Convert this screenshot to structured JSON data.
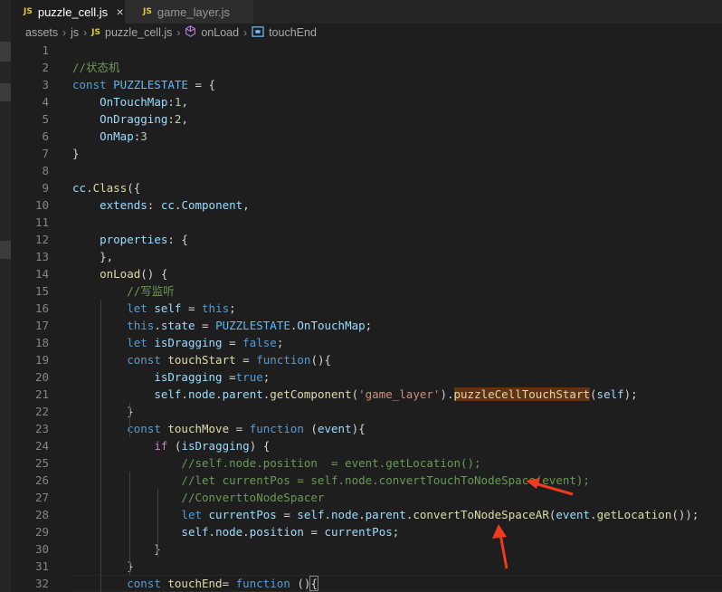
{
  "tabs": [
    {
      "badge": "JS",
      "label": "puzzle_cell.js",
      "active": true,
      "close": "×"
    },
    {
      "badge": "JS",
      "label": "game_layer.js",
      "active": false
    }
  ],
  "breadcrumb": {
    "parts": [
      "assets",
      "js",
      "puzzle_cell.js",
      "onLoad",
      "touchEnd"
    ],
    "js_badge": "JS",
    "separator": "›"
  },
  "colors": {
    "comment": "#6a9955",
    "keyword": "#569cd6",
    "control": "#c586c0",
    "function": "#dcdcaa",
    "variable": "#9cdcfe",
    "constant": "#4fc1ff",
    "class": "#4ec9b0",
    "number": "#b5cea8",
    "string": "#ce9178",
    "plain": "#d4d4d4",
    "arrow": "#f03a20"
  },
  "code": [
    {
      "n": "1",
      "tokens": []
    },
    {
      "n": "2",
      "tokens": [
        [
          "comment",
          "//状态机"
        ]
      ]
    },
    {
      "n": "3",
      "tokens": [
        [
          "keyword",
          "const "
        ],
        [
          "constant",
          "PUZZLESTATE"
        ],
        [
          "plain",
          " = {"
        ]
      ]
    },
    {
      "n": "4",
      "tokens": [
        [
          "plain",
          "    "
        ],
        [
          "variable",
          "OnTouchMap"
        ],
        [
          "plain",
          ":"
        ],
        [
          "number",
          "1"
        ],
        [
          "plain",
          ","
        ]
      ]
    },
    {
      "n": "5",
      "tokens": [
        [
          "plain",
          "    "
        ],
        [
          "variable",
          "OnDragging"
        ],
        [
          "plain",
          ":"
        ],
        [
          "number",
          "2"
        ],
        [
          "plain",
          ","
        ]
      ]
    },
    {
      "n": "6",
      "tokens": [
        [
          "plain",
          "    "
        ],
        [
          "variable",
          "OnMap"
        ],
        [
          "plain",
          ":"
        ],
        [
          "number",
          "3"
        ]
      ]
    },
    {
      "n": "7",
      "tokens": [
        [
          "plain",
          "}"
        ]
      ]
    },
    {
      "n": "8",
      "tokens": []
    },
    {
      "n": "9",
      "tokens": [
        [
          "variable",
          "cc"
        ],
        [
          "plain",
          "."
        ],
        [
          "function",
          "Class"
        ],
        [
          "plain",
          "({"
        ]
      ]
    },
    {
      "n": "10",
      "tokens": [
        [
          "plain",
          "    "
        ],
        [
          "variable",
          "extends"
        ],
        [
          "plain",
          ": "
        ],
        [
          "variable",
          "cc"
        ],
        [
          "plain",
          "."
        ],
        [
          "variable",
          "Component"
        ],
        [
          "plain",
          ","
        ]
      ]
    },
    {
      "n": "11",
      "tokens": []
    },
    {
      "n": "12",
      "tokens": [
        [
          "plain",
          "    "
        ],
        [
          "variable",
          "properties"
        ],
        [
          "plain",
          ": {"
        ]
      ]
    },
    {
      "n": "13",
      "tokens": [
        [
          "plain",
          "    },"
        ]
      ]
    },
    {
      "n": "14",
      "tokens": [
        [
          "plain",
          "    "
        ],
        [
          "function",
          "onLoad"
        ],
        [
          "plain",
          "() {"
        ]
      ]
    },
    {
      "n": "15",
      "tokens": [
        [
          "plain",
          "        "
        ],
        [
          "comment",
          "//写监听"
        ]
      ]
    },
    {
      "n": "16",
      "tokens": [
        [
          "plain",
          "        "
        ],
        [
          "keyword",
          "let "
        ],
        [
          "variable",
          "self"
        ],
        [
          "plain",
          " = "
        ],
        [
          "keyword",
          "this"
        ],
        [
          "plain",
          ";"
        ]
      ]
    },
    {
      "n": "17",
      "tokens": [
        [
          "plain",
          "        "
        ],
        [
          "keyword",
          "this"
        ],
        [
          "plain",
          "."
        ],
        [
          "variable",
          "state"
        ],
        [
          "plain",
          " = "
        ],
        [
          "constant",
          "PUZZLESTATE"
        ],
        [
          "plain",
          "."
        ],
        [
          "variable",
          "OnTouchMap"
        ],
        [
          "plain",
          ";"
        ]
      ]
    },
    {
      "n": "18",
      "tokens": [
        [
          "plain",
          "        "
        ],
        [
          "keyword",
          "let "
        ],
        [
          "variable",
          "isDragging"
        ],
        [
          "plain",
          " = "
        ],
        [
          "keyword",
          "false"
        ],
        [
          "plain",
          ";"
        ]
      ]
    },
    {
      "n": "19",
      "tokens": [
        [
          "plain",
          "        "
        ],
        [
          "keyword",
          "const "
        ],
        [
          "function",
          "touchStart"
        ],
        [
          "plain",
          " = "
        ],
        [
          "keyword",
          "function"
        ],
        [
          "plain",
          "(){"
        ]
      ]
    },
    {
      "n": "20",
      "tokens": [
        [
          "plain",
          "            "
        ],
        [
          "variable",
          "isDragging"
        ],
        [
          "plain",
          " ="
        ],
        [
          "keyword",
          "true"
        ],
        [
          "plain",
          ";"
        ]
      ]
    },
    {
      "n": "21",
      "tokens": [
        [
          "plain",
          "            "
        ],
        [
          "variable",
          "self"
        ],
        [
          "plain",
          "."
        ],
        [
          "variable",
          "node"
        ],
        [
          "plain",
          "."
        ],
        [
          "variable",
          "parent"
        ],
        [
          "plain",
          "."
        ],
        [
          "function",
          "getComponent"
        ],
        [
          "plain",
          "("
        ],
        [
          "string",
          "'game_layer'"
        ],
        [
          "plain",
          ")."
        ],
        [
          "function hl",
          "puzzleCellTouchStart"
        ],
        [
          "plain",
          "("
        ],
        [
          "variable",
          "self"
        ],
        [
          "plain",
          ");"
        ]
      ]
    },
    {
      "n": "22",
      "tokens": [
        [
          "plain",
          "        }"
        ]
      ]
    },
    {
      "n": "23",
      "tokens": [
        [
          "plain",
          "        "
        ],
        [
          "keyword",
          "const "
        ],
        [
          "function",
          "touchMove"
        ],
        [
          "plain",
          " = "
        ],
        [
          "keyword",
          "function"
        ],
        [
          "plain",
          " ("
        ],
        [
          "variable",
          "event"
        ],
        [
          "plain",
          "){"
        ]
      ]
    },
    {
      "n": "24",
      "tokens": [
        [
          "plain",
          "            "
        ],
        [
          "control",
          "if"
        ],
        [
          "plain",
          " ("
        ],
        [
          "variable",
          "isDragging"
        ],
        [
          "plain",
          ") {"
        ]
      ]
    },
    {
      "n": "25",
      "tokens": [
        [
          "plain",
          "                "
        ],
        [
          "comment",
          "//self.node.position  = event.getLocation();"
        ]
      ]
    },
    {
      "n": "26",
      "tokens": [
        [
          "plain",
          "                "
        ],
        [
          "comment",
          "//let currentPos = self.node.convertTouchToNodeSpace(event);"
        ]
      ]
    },
    {
      "n": "27",
      "tokens": [
        [
          "plain",
          "                "
        ],
        [
          "comment",
          "//ConverttoNodeSpacer"
        ]
      ]
    },
    {
      "n": "28",
      "tokens": [
        [
          "plain",
          "                "
        ],
        [
          "keyword",
          "let "
        ],
        [
          "variable",
          "currentPos"
        ],
        [
          "plain",
          " = "
        ],
        [
          "variable",
          "self"
        ],
        [
          "plain",
          "."
        ],
        [
          "variable",
          "node"
        ],
        [
          "plain",
          "."
        ],
        [
          "variable",
          "parent"
        ],
        [
          "plain",
          "."
        ],
        [
          "function",
          "convertToNodeSpaceAR"
        ],
        [
          "plain",
          "("
        ],
        [
          "variable",
          "event"
        ],
        [
          "plain",
          "."
        ],
        [
          "function",
          "getLocation"
        ],
        [
          "plain",
          "());"
        ]
      ]
    },
    {
      "n": "29",
      "tokens": [
        [
          "plain",
          "                "
        ],
        [
          "variable",
          "self"
        ],
        [
          "plain",
          "."
        ],
        [
          "variable",
          "node"
        ],
        [
          "plain",
          "."
        ],
        [
          "variable",
          "position"
        ],
        [
          "plain",
          " = "
        ],
        [
          "variable",
          "currentPos"
        ],
        [
          "plain",
          ";"
        ]
      ]
    },
    {
      "n": "30",
      "tokens": [
        [
          "plain",
          "            }"
        ]
      ]
    },
    {
      "n": "31",
      "tokens": [
        [
          "plain",
          "        }"
        ]
      ]
    },
    {
      "n": "32",
      "tokens": [
        [
          "plain",
          "        "
        ],
        [
          "keyword",
          "const "
        ],
        [
          "function",
          "touchEnd"
        ],
        [
          "plain",
          "= "
        ],
        [
          "keyword",
          "function"
        ],
        [
          "plain",
          " ()"
        ],
        [
          "plain box",
          "{"
        ]
      ]
    }
  ]
}
